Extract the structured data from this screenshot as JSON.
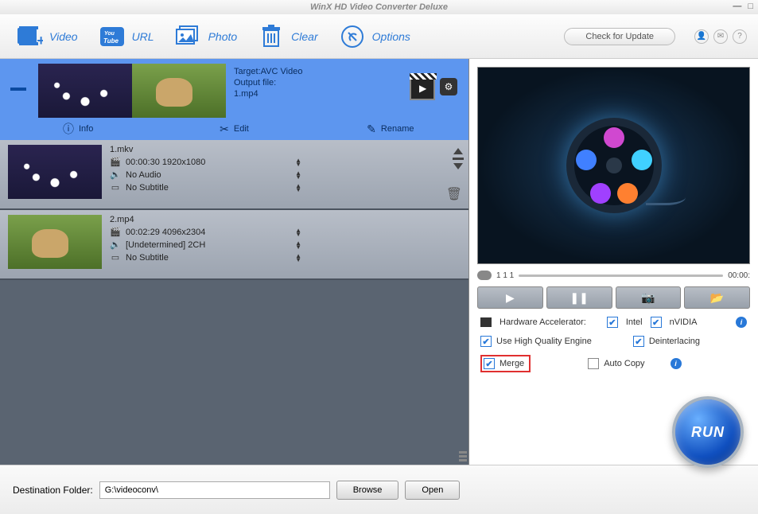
{
  "window": {
    "title": "WinX HD Video Converter Deluxe"
  },
  "toolbar": {
    "video": "Video",
    "url": "URL",
    "photo": "Photo",
    "clear": "Clear",
    "options": "Options",
    "update": "Check for Update"
  },
  "selected": {
    "target_label": "Target:",
    "target_value": "AVC Video",
    "output_label": "Output file:",
    "output_value": "1.mp4"
  },
  "actions": {
    "info": "Info",
    "edit": "Edit",
    "rename": "Rename"
  },
  "files": [
    {
      "name": "1.mkv",
      "video": "00:00:30  1920x1080",
      "audio": "No Audio",
      "subtitle": "No Subtitle",
      "thumb_class": "flowers"
    },
    {
      "name": "2.mp4",
      "video": "00:02:29  4096x2304",
      "audio": "[Undetermined] 2CH",
      "subtitle": "No Subtitle",
      "thumb_class": "puppy"
    }
  ],
  "timeline": {
    "start": "1 1 1",
    "end": "00:00:"
  },
  "options": {
    "hw_label": "Hardware Accelerator:",
    "intel": "Intel",
    "nvidia": "nVIDIA",
    "hq": "Use High Quality Engine",
    "deint": "Deinterlacing",
    "merge": "Merge",
    "autocopy": "Auto Copy"
  },
  "run": "RUN",
  "footer": {
    "label": "Destination Folder:",
    "path": "G:\\videoconv\\",
    "browse": "Browse",
    "open": "Open"
  }
}
